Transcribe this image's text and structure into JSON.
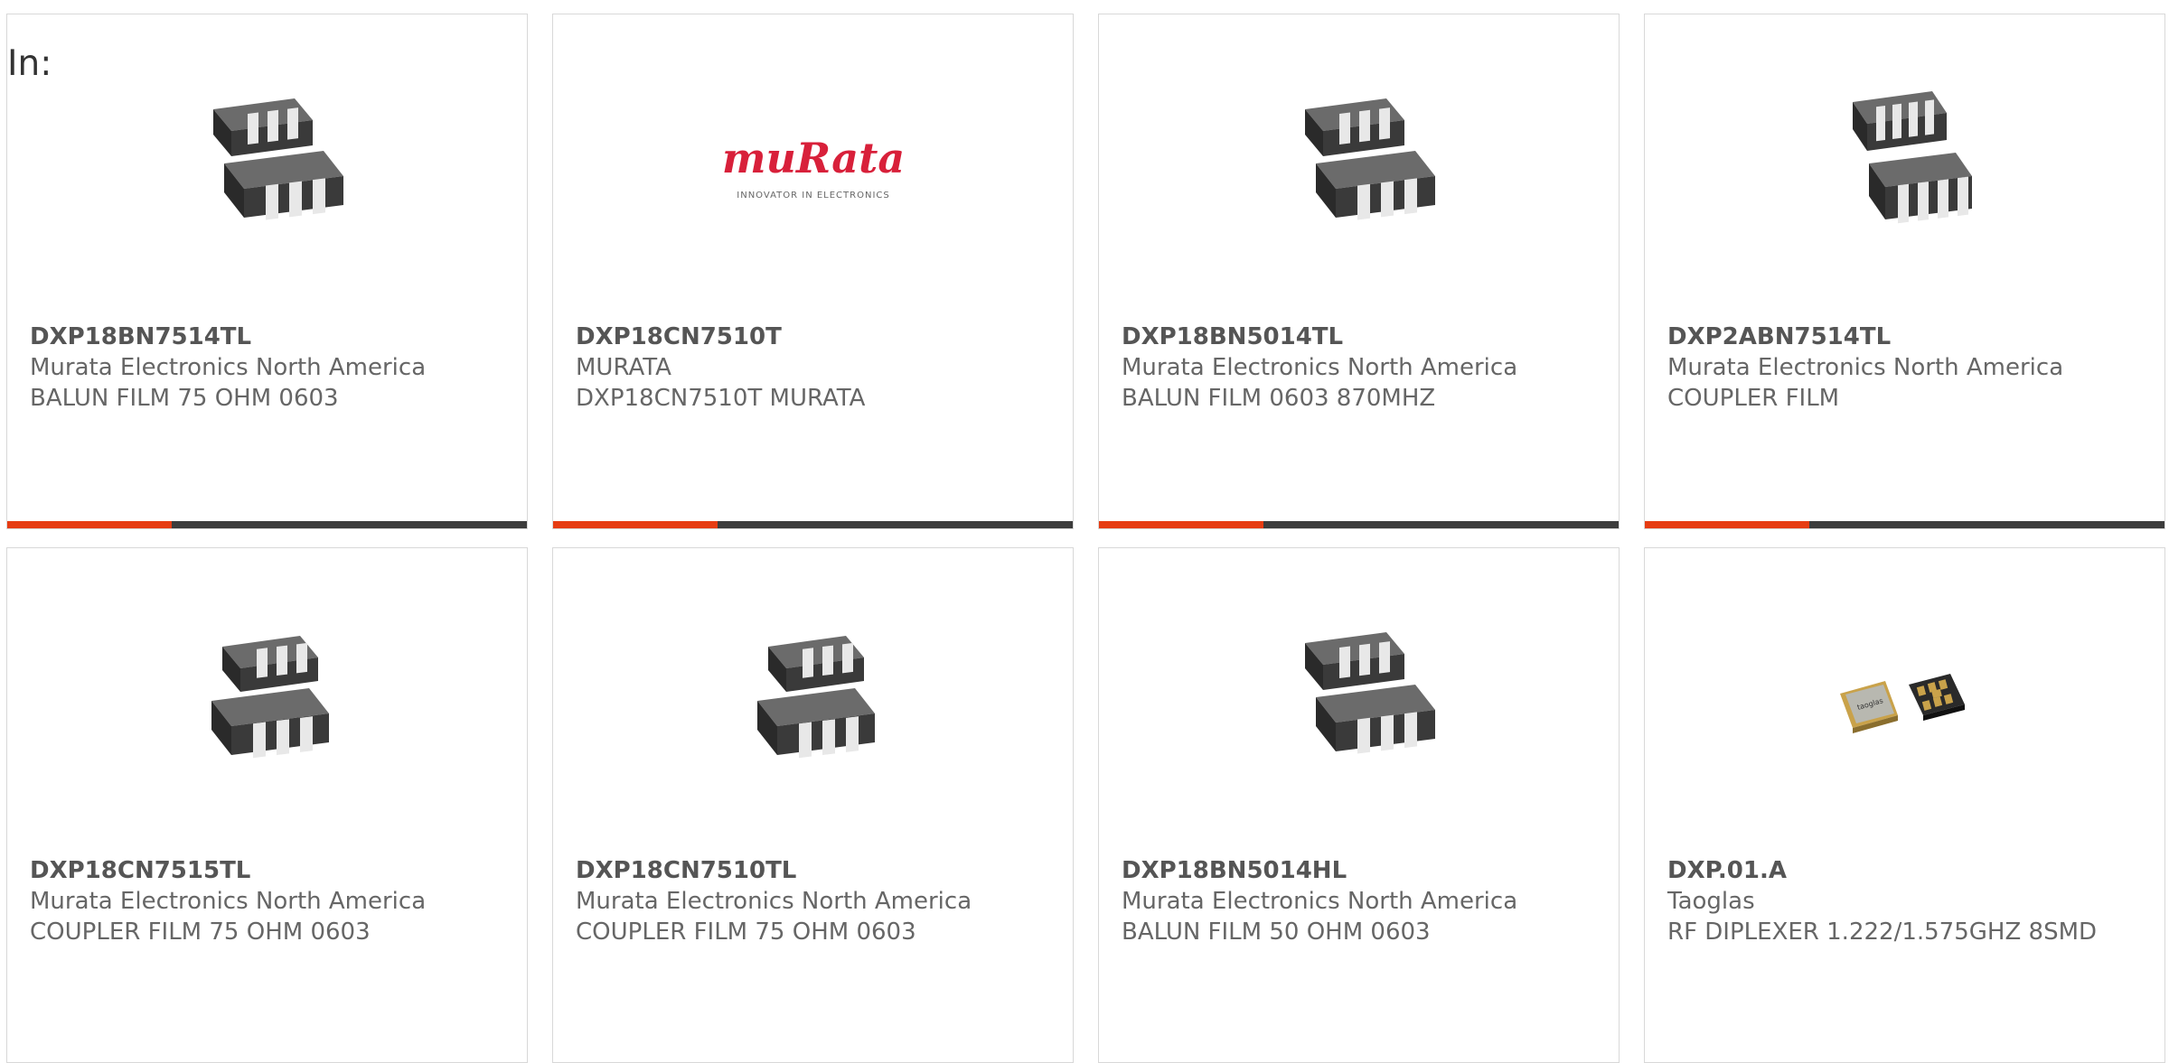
{
  "page": {
    "in_label": "In:"
  },
  "colors": {
    "accent": "#e63c12",
    "bar_dark": "#3c3c3c",
    "card_border": "#d8d8d8",
    "murata_red": "#d8203a"
  },
  "products": [
    {
      "part": "DXP18BN7514TL",
      "manufacturer": "Murata Electronics North America",
      "description": "BALUN FILM 75 OHM 0603",
      "image_icon": "chip-4-terminal-icon"
    },
    {
      "part": "DXP18CN7510T",
      "manufacturer": "MURATA",
      "description": "DXP18CN7510T MURATA",
      "image_icon": "murata-logo",
      "logo": {
        "brand": "muRata",
        "tagline": "INNOVATOR IN ELECTRONICS"
      }
    },
    {
      "part": "DXP18BN5014TL",
      "manufacturer": "Murata Electronics North America",
      "description": "BALUN FILM 0603 870MHZ",
      "image_icon": "chip-4-terminal-icon"
    },
    {
      "part": "DXP2ABN7514TL",
      "manufacturer": "Murata Electronics North America",
      "description": "COUPLER FILM",
      "image_icon": "chip-6-terminal-icon"
    },
    {
      "part": "DXP18CN7515TL",
      "manufacturer": "Murata Electronics North America",
      "description": "COUPLER FILM 75 OHM 0603",
      "image_icon": "chip-4-terminal-icon"
    },
    {
      "part": "DXP18CN7510TL",
      "manufacturer": "Murata Electronics North America",
      "description": "COUPLER FILM 75 OHM 0603",
      "image_icon": "chip-4-terminal-icon"
    },
    {
      "part": "DXP18BN5014HL",
      "manufacturer": "Murata Electronics North America",
      "description": "BALUN FILM 50 OHM 0603",
      "image_icon": "chip-4-terminal-icon"
    },
    {
      "part": "DXP.01.A",
      "manufacturer": "Taoglas",
      "description": "RF DIPLEXER 1.222/1.575GHZ 8SMD",
      "image_icon": "diplexer-8smd-icon",
      "chip_label": "taoglas"
    }
  ]
}
